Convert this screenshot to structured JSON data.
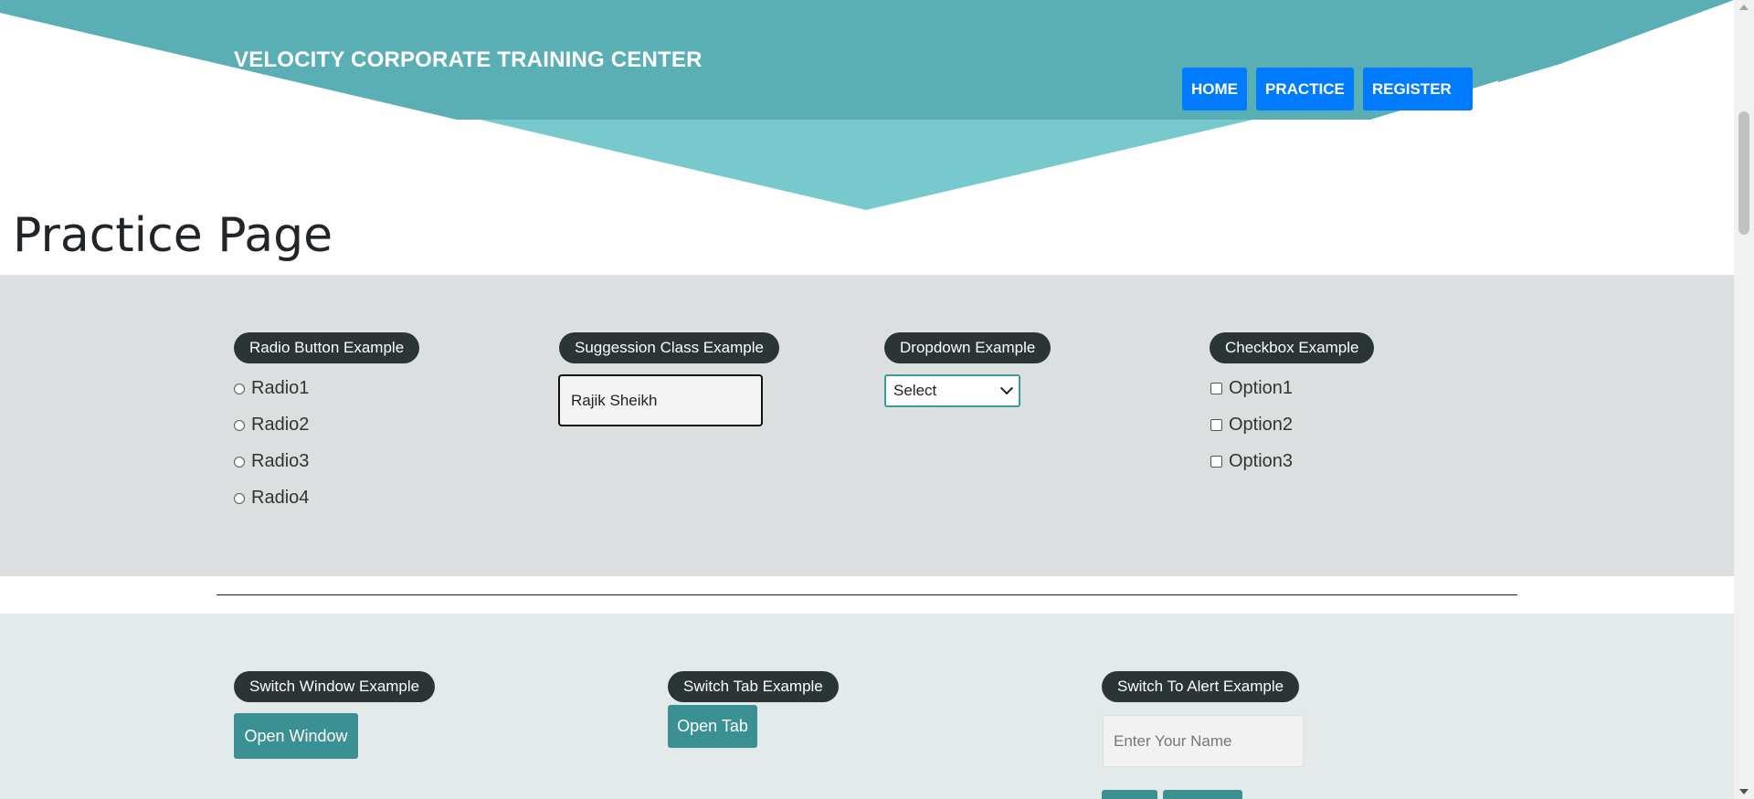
{
  "header": {
    "brand": "VELOCITY CORPORATE TRAINING CENTER",
    "nav": [
      "HOME",
      "PRACTICE",
      "REGISTER"
    ]
  },
  "page_title": "Practice Page",
  "radio_section": {
    "label": "Radio Button Example",
    "options": [
      "Radio1",
      "Radio2",
      "Radio3",
      "Radio4"
    ]
  },
  "suggestion_section": {
    "label": "Suggession Class Example",
    "value": "Rajik Sheikh"
  },
  "dropdown_section": {
    "label": "Dropdown Example",
    "selected": "Select"
  },
  "checkbox_section": {
    "label": "Checkbox Example",
    "options": [
      "Option1",
      "Option2",
      "Option3"
    ]
  },
  "switch_window": {
    "label": "Switch Window Example",
    "button": "Open Window"
  },
  "switch_tab": {
    "label": "Switch Tab Example",
    "button": "Open Tab"
  },
  "switch_alert": {
    "label": "Switch To Alert Example",
    "placeholder": "Enter Your Name"
  },
  "colors": {
    "header_teal": "#5aafb4",
    "header_light": "#7ccacf",
    "nav_blue": "#007bff",
    "pill_dark": "#2b3536",
    "button_teal": "#3b9093"
  }
}
